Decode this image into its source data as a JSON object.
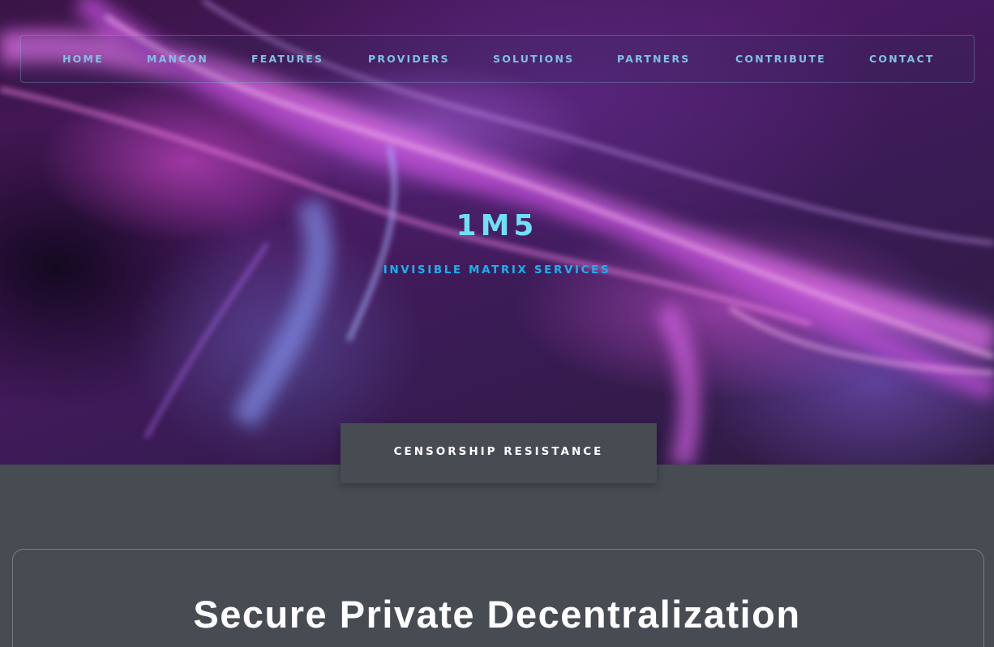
{
  "nav": {
    "items": [
      {
        "label": "HOME"
      },
      {
        "label": "MANCON"
      },
      {
        "label": "FEATURES"
      },
      {
        "label": "PROVIDERS"
      },
      {
        "label": "SOLUTIONS"
      },
      {
        "label": "PARTNERS"
      },
      {
        "label": "CONTRIBUTE"
      },
      {
        "label": "CONTACT"
      }
    ]
  },
  "hero": {
    "title": "1M5",
    "subtitle": "INVISIBLE MATRIX SERVICES"
  },
  "tab": {
    "label": "CENSORSHIP RESISTANCE"
  },
  "section": {
    "heading": "Secure Private Decentralization"
  },
  "colors": {
    "nav_text": "#7fc2e4",
    "title": "#6fe0f4",
    "subtitle": "#17b2ee",
    "panel_bg": "#474c53"
  }
}
